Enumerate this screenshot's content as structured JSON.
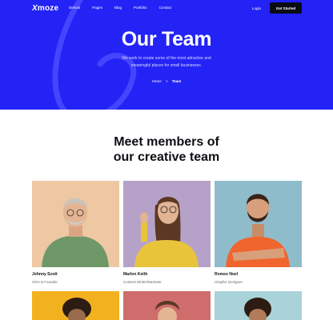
{
  "nav": {
    "logo": "moze",
    "logo_mark": "X",
    "links": [
      "Demos",
      "Pages",
      "Blog",
      "Portfolio",
      "Contact"
    ],
    "login": "Login",
    "cta": "Get Started"
  },
  "hero": {
    "title": "Our Team",
    "subtitle": "We work to create some of the most attractive and meaningful places for small businesses.",
    "breadcrumb": {
      "home": "Home",
      "separator": ">",
      "current": "Team"
    }
  },
  "section": {
    "title_line1": "Meet members of",
    "title_line2": "our creative team"
  },
  "members": [
    {
      "name": "Johnny Scott",
      "role": "CEO & Founder"
    },
    {
      "name": "Marlon Keith",
      "role": "Content Writer/Marketer"
    },
    {
      "name": "Romeo Noel",
      "role": "Graphic Designer"
    }
  ],
  "colors": {
    "brand_blue": "#2323f6",
    "cta_bg": "#0b0b14"
  }
}
